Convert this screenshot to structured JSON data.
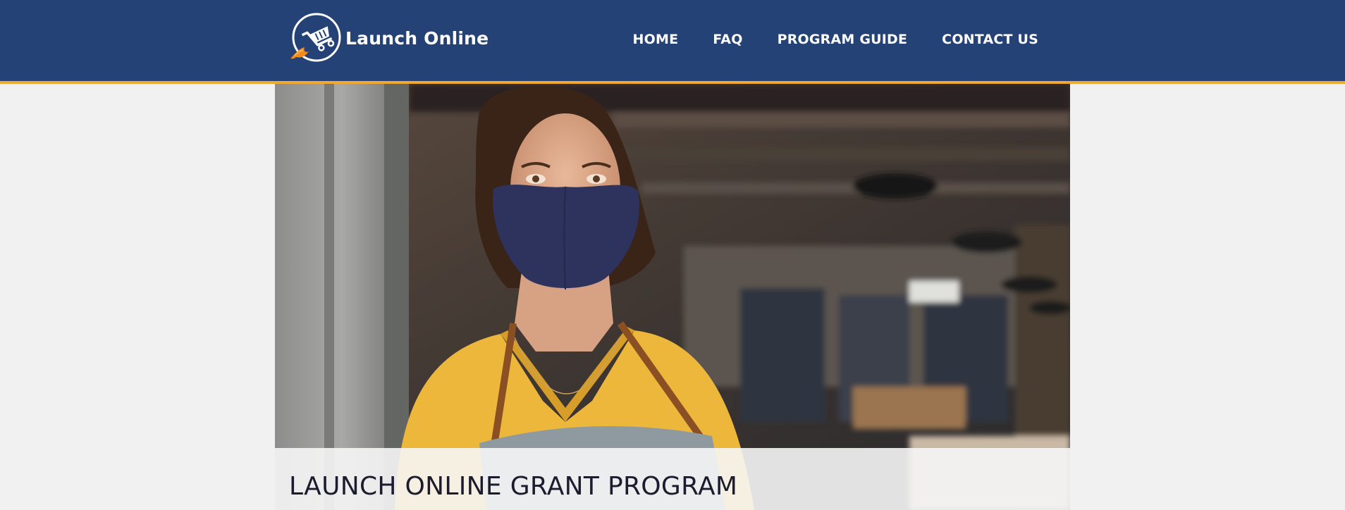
{
  "header": {
    "brand_name": "Launch Online",
    "logo_icon": "rocket-shopping-cart-icon",
    "nav": [
      {
        "label": "HOME"
      },
      {
        "label": "FAQ"
      },
      {
        "label": "PROGRAM GUIDE"
      },
      {
        "label": "CONTACT US"
      }
    ]
  },
  "hero": {
    "title": "LAUNCH ONLINE GRANT PROGRAM",
    "image_subject": "shop-owner-in-mask-photo"
  },
  "colors": {
    "header_bg": "#244276",
    "header_accent": "#f0a830",
    "page_bg": "#f1f1f1",
    "logo_flame": "#f08a1c"
  }
}
